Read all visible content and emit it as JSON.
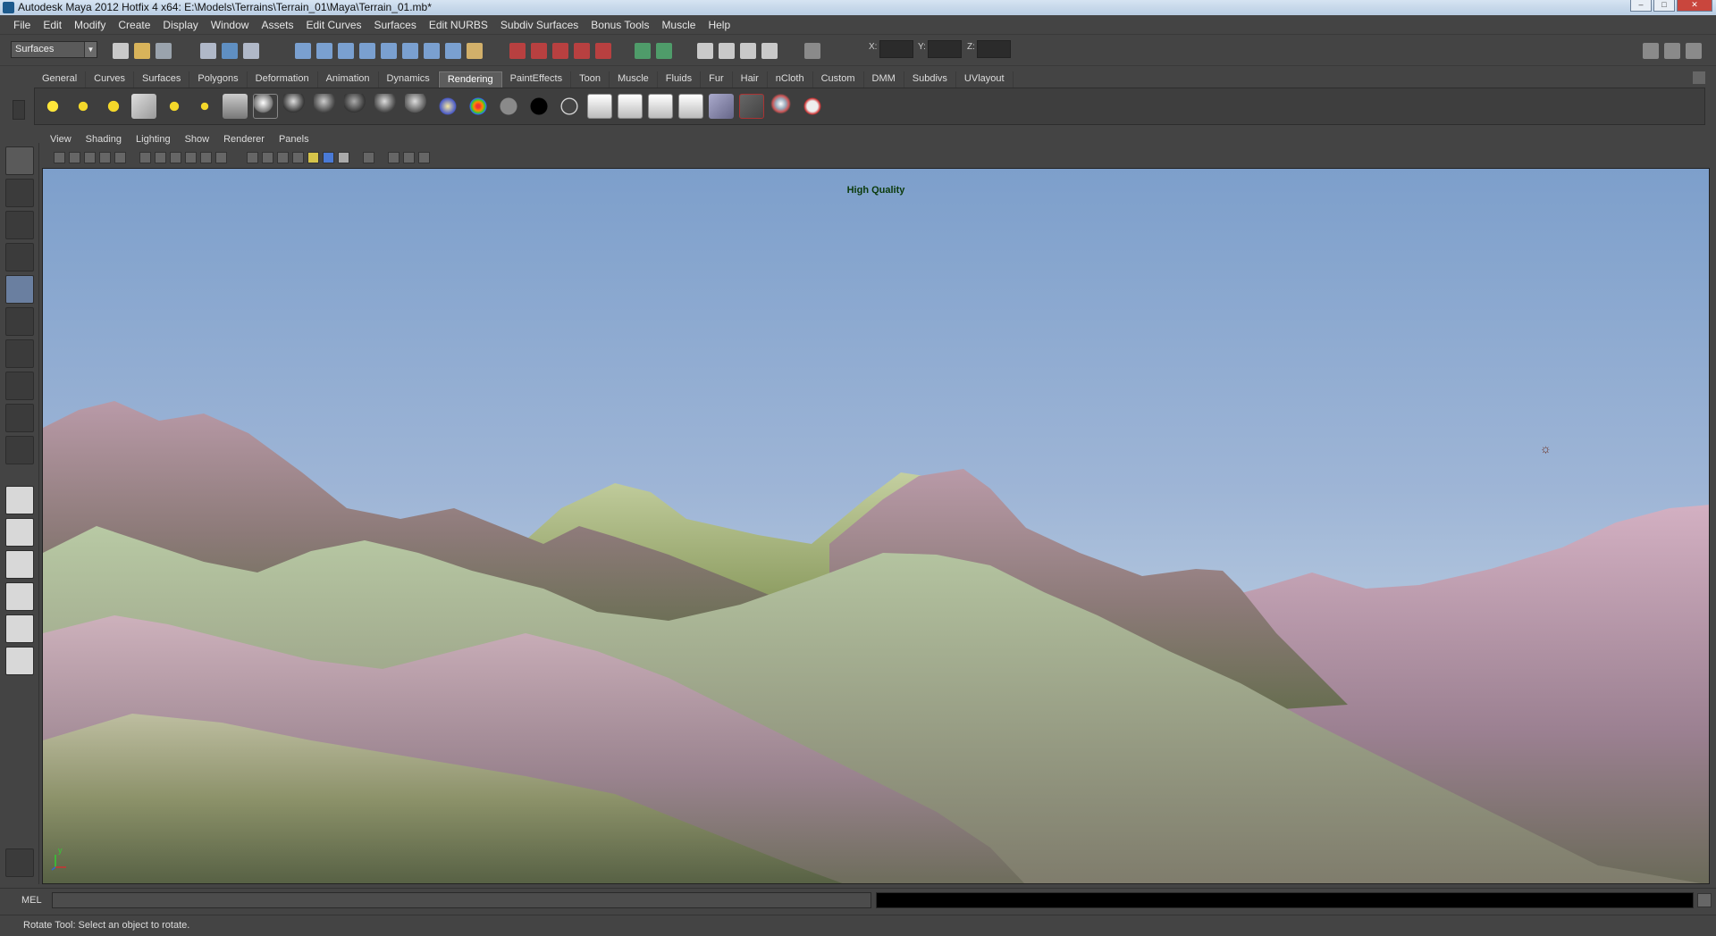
{
  "window": {
    "title": "Autodesk Maya 2012 Hotfix 4 x64: E:\\Models\\Terrains\\Terrain_01\\Maya\\Terrain_01.mb*"
  },
  "menubar": {
    "items": [
      {
        "label": "File"
      },
      {
        "label": "Edit"
      },
      {
        "label": "Modify"
      },
      {
        "label": "Create"
      },
      {
        "label": "Display"
      },
      {
        "label": "Window"
      },
      {
        "label": "Assets"
      },
      {
        "label": "Edit Curves"
      },
      {
        "label": "Surfaces"
      },
      {
        "label": "Edit NURBS"
      },
      {
        "label": "Subdiv Surfaces"
      },
      {
        "label": "Bonus Tools"
      },
      {
        "label": "Muscle"
      },
      {
        "label": "Help"
      }
    ]
  },
  "statusline": {
    "mode_selected": "Surfaces",
    "x_label": "X:",
    "y_label": "Y:",
    "z_label": "Z:",
    "x_value": "",
    "y_value": "",
    "z_value": ""
  },
  "shelf": {
    "tabs": [
      {
        "label": "General"
      },
      {
        "label": "Curves"
      },
      {
        "label": "Surfaces"
      },
      {
        "label": "Polygons"
      },
      {
        "label": "Deformation"
      },
      {
        "label": "Animation"
      },
      {
        "label": "Dynamics"
      },
      {
        "label": "Rendering"
      },
      {
        "label": "PaintEffects"
      },
      {
        "label": "Toon"
      },
      {
        "label": "Muscle"
      },
      {
        "label": "Fluids"
      },
      {
        "label": "Fur"
      },
      {
        "label": "Hair"
      },
      {
        "label": "nCloth"
      },
      {
        "label": "Custom"
      },
      {
        "label": "DMM"
      },
      {
        "label": "Subdivs"
      },
      {
        "label": "UVlayout"
      }
    ],
    "active_tab": "Rendering",
    "icons": [
      "ambient-light-icon",
      "directional-light-icon",
      "point-light-icon",
      "spot-light-icon",
      "area-light-icon",
      "volume-light-icon",
      "hypershade-icon",
      "blinn-icon",
      "lambert-icon",
      "phong-icon",
      "phonge-icon",
      "anisotropic-icon",
      "ramp-shader-icon",
      "layered-shader-icon",
      "surface-shader-icon",
      "use-background-icon",
      "black-shader-icon",
      "white-shader-icon",
      "render-current-frame-icon",
      "ipr-render-icon",
      "render-settings-icon",
      "render-view-icon",
      "batch-render-icon",
      "cancel-batch-icon",
      "shader-ball-icon",
      "paint-shader-icon"
    ]
  },
  "panel": {
    "menus": [
      {
        "label": "View"
      },
      {
        "label": "Shading"
      },
      {
        "label": "Lighting"
      },
      {
        "label": "Show"
      },
      {
        "label": "Renderer"
      },
      {
        "label": "Panels"
      }
    ],
    "viewport_overlay": "High Quality",
    "axis_label": "y"
  },
  "toolbox": {
    "tools": [
      "select-tool-icon",
      "lasso-tool-icon",
      "paint-select-tool-icon",
      "move-tool-icon",
      "rotate-tool-icon",
      "scale-tool-icon",
      "universal-manipulator-icon",
      "soft-modify-icon",
      "show-manipulator-icon",
      "last-tool-icon"
    ],
    "layouts": [
      "single-perspective-layout-icon",
      "four-view-layout-icon",
      "outliner-persp-layout-icon",
      "graph-persp-layout-icon",
      "hypershade-persp-layout-icon",
      "persp-graph-layout-icon"
    ]
  },
  "commandline": {
    "label": "MEL",
    "input_value": "",
    "output_value": ""
  },
  "helpline": {
    "text": "Rotate Tool: Select an object to rotate."
  }
}
